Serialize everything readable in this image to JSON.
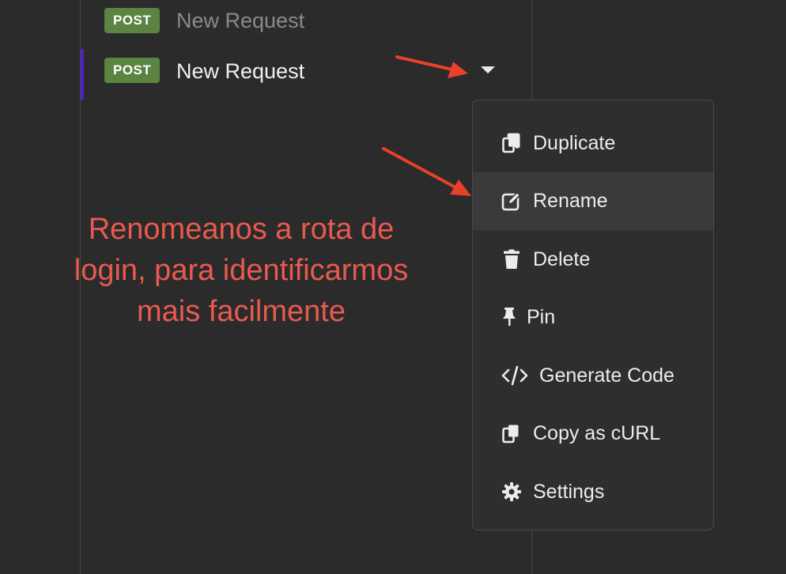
{
  "requests": [
    {
      "method": "POST",
      "name": "New Request",
      "active": false
    },
    {
      "method": "POST",
      "name": "New Request",
      "active": true
    }
  ],
  "context_menu": {
    "items": [
      {
        "label": "Duplicate",
        "icon": "duplicate-icon"
      },
      {
        "label": "Rename",
        "icon": "edit-icon",
        "highlighted": true
      },
      {
        "label": "Delete",
        "icon": "trash-icon"
      },
      {
        "label": "Pin",
        "icon": "pin-icon"
      },
      {
        "label": "Generate Code",
        "icon": "code-icon"
      },
      {
        "label": "Copy as cURL",
        "icon": "copy-icon"
      },
      {
        "label": "Settings",
        "icon": "gear-icon"
      }
    ]
  },
  "annotation": {
    "line1": "Renomeanos a rota de",
    "line2": "login, para identificarmos",
    "line3": "mais facilmente"
  },
  "colors": {
    "background": "#2b2b2b",
    "post_badge": "#5b8342",
    "active_indicator": "#4d22c7",
    "annotation": "#e85a4f",
    "arrow": "#e8402a"
  }
}
